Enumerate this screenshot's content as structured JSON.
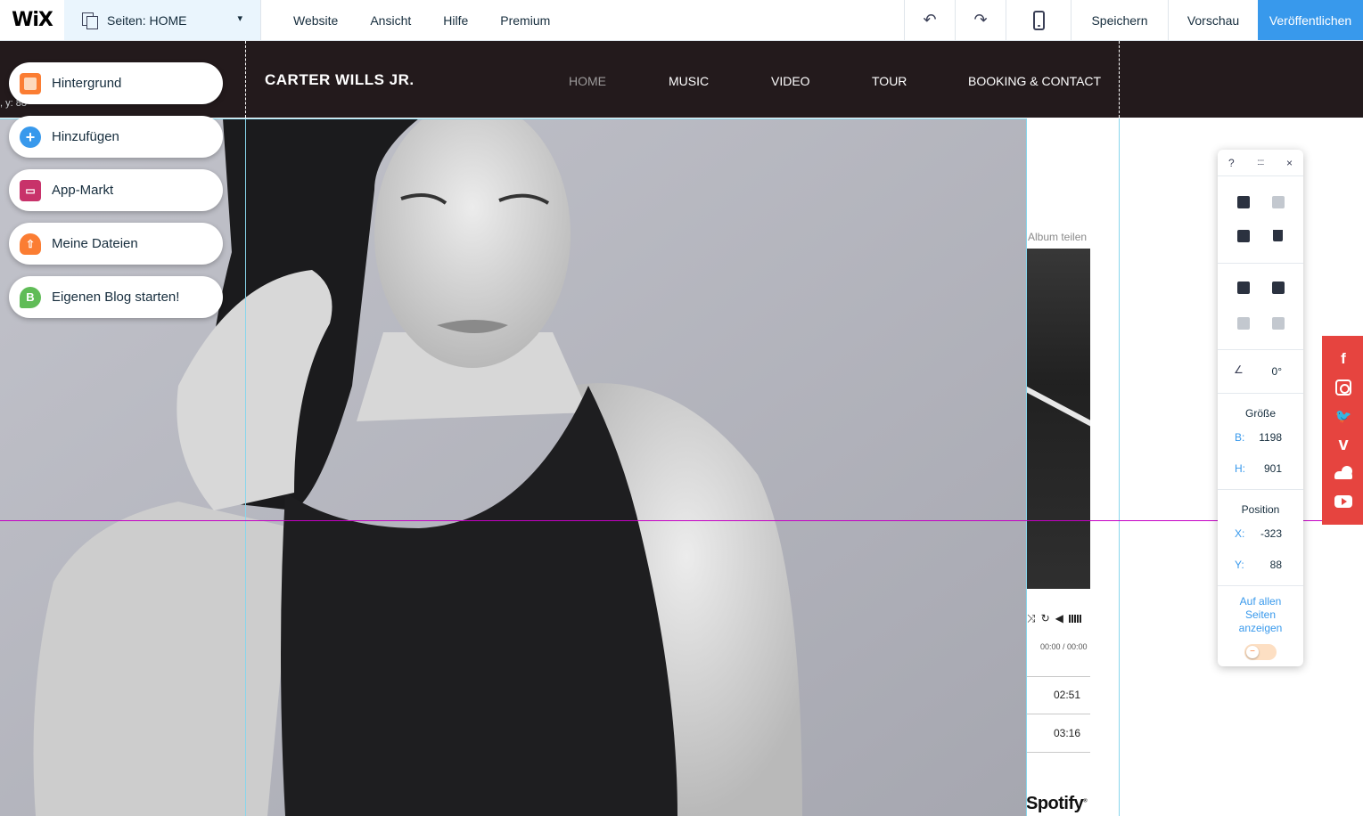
{
  "topbar": {
    "logo": "WiX",
    "pages_label": "Seiten: HOME",
    "menu": [
      "Website",
      "Ansicht",
      "Hilfe",
      "Premium"
    ],
    "undo_icon": "↶",
    "redo_icon": "↷",
    "save_label": "Speichern",
    "preview_label": "Vorschau",
    "publish_label": "Veröffentlichen",
    "collapse_icon": "ˆ",
    "dropdown_icon": "▾"
  },
  "site": {
    "name": "CARTER WILLS JR.",
    "nav": [
      "HOME",
      "MUSIC",
      "VIDEO",
      "TOUR",
      "BOOKING & CONTACT"
    ],
    "active_nav": "HOME"
  },
  "left_panel": {
    "items": [
      {
        "label": "Hintergrund",
        "icon": "background-icon",
        "color": "#fb7d33"
      },
      {
        "label": "Hinzufügen",
        "icon": "add-icon",
        "glyph": "+",
        "color": "#3899ec"
      },
      {
        "label": "App-Markt",
        "icon": "app-market-icon",
        "glyph": "▭",
        "color": "#c8326a"
      },
      {
        "label": "Meine Dateien",
        "icon": "upload-cloud-icon",
        "glyph": "⇧",
        "color": "#fb7d33"
      },
      {
        "label": "Eigenen Blog starten!",
        "icon": "blog-icon",
        "glyph": "B",
        "color": "#60bc57"
      }
    ],
    "coords_hint": ", y: 88"
  },
  "music_player": {
    "share_label": "Album teilen",
    "timecode": "00:00 / 00:00",
    "tracks": [
      {
        "duration": "02:51"
      },
      {
        "duration": "03:16"
      }
    ],
    "brand": "Spotify",
    "brand_mark": "®",
    "shuffle_icon": "⤨",
    "repeat_icon": "↻",
    "volume_icon": "◀"
  },
  "inspector": {
    "help": "?",
    "grip": "::::",
    "close": "×",
    "rotation": "0°",
    "rotation_icon": "∠",
    "size_label": "Größe",
    "width_key": "B:",
    "width_value": "1198",
    "height_key": "H:",
    "height_value": "901",
    "position_label": "Position",
    "x_key": "X:",
    "x_value": "-323",
    "y_key": "Y:",
    "y_value": "88",
    "show_all_label": "Auf allen Seiten anzeigen",
    "toggle_glyph": "−"
  },
  "social": {
    "items": [
      "facebook-icon",
      "instagram-icon",
      "twitter-icon",
      "vimeo-icon",
      "soundcloud-icon",
      "youtube-icon"
    ],
    "facebook_glyph": "f",
    "twitter_glyph": "🐦",
    "vimeo_glyph": "v"
  },
  "colors": {
    "accent": "#3899ec",
    "header_bg": "#231a1c",
    "social_bg": "#e6443f",
    "guide_h": "#c400c4",
    "guide_v": "#88d6ec"
  }
}
